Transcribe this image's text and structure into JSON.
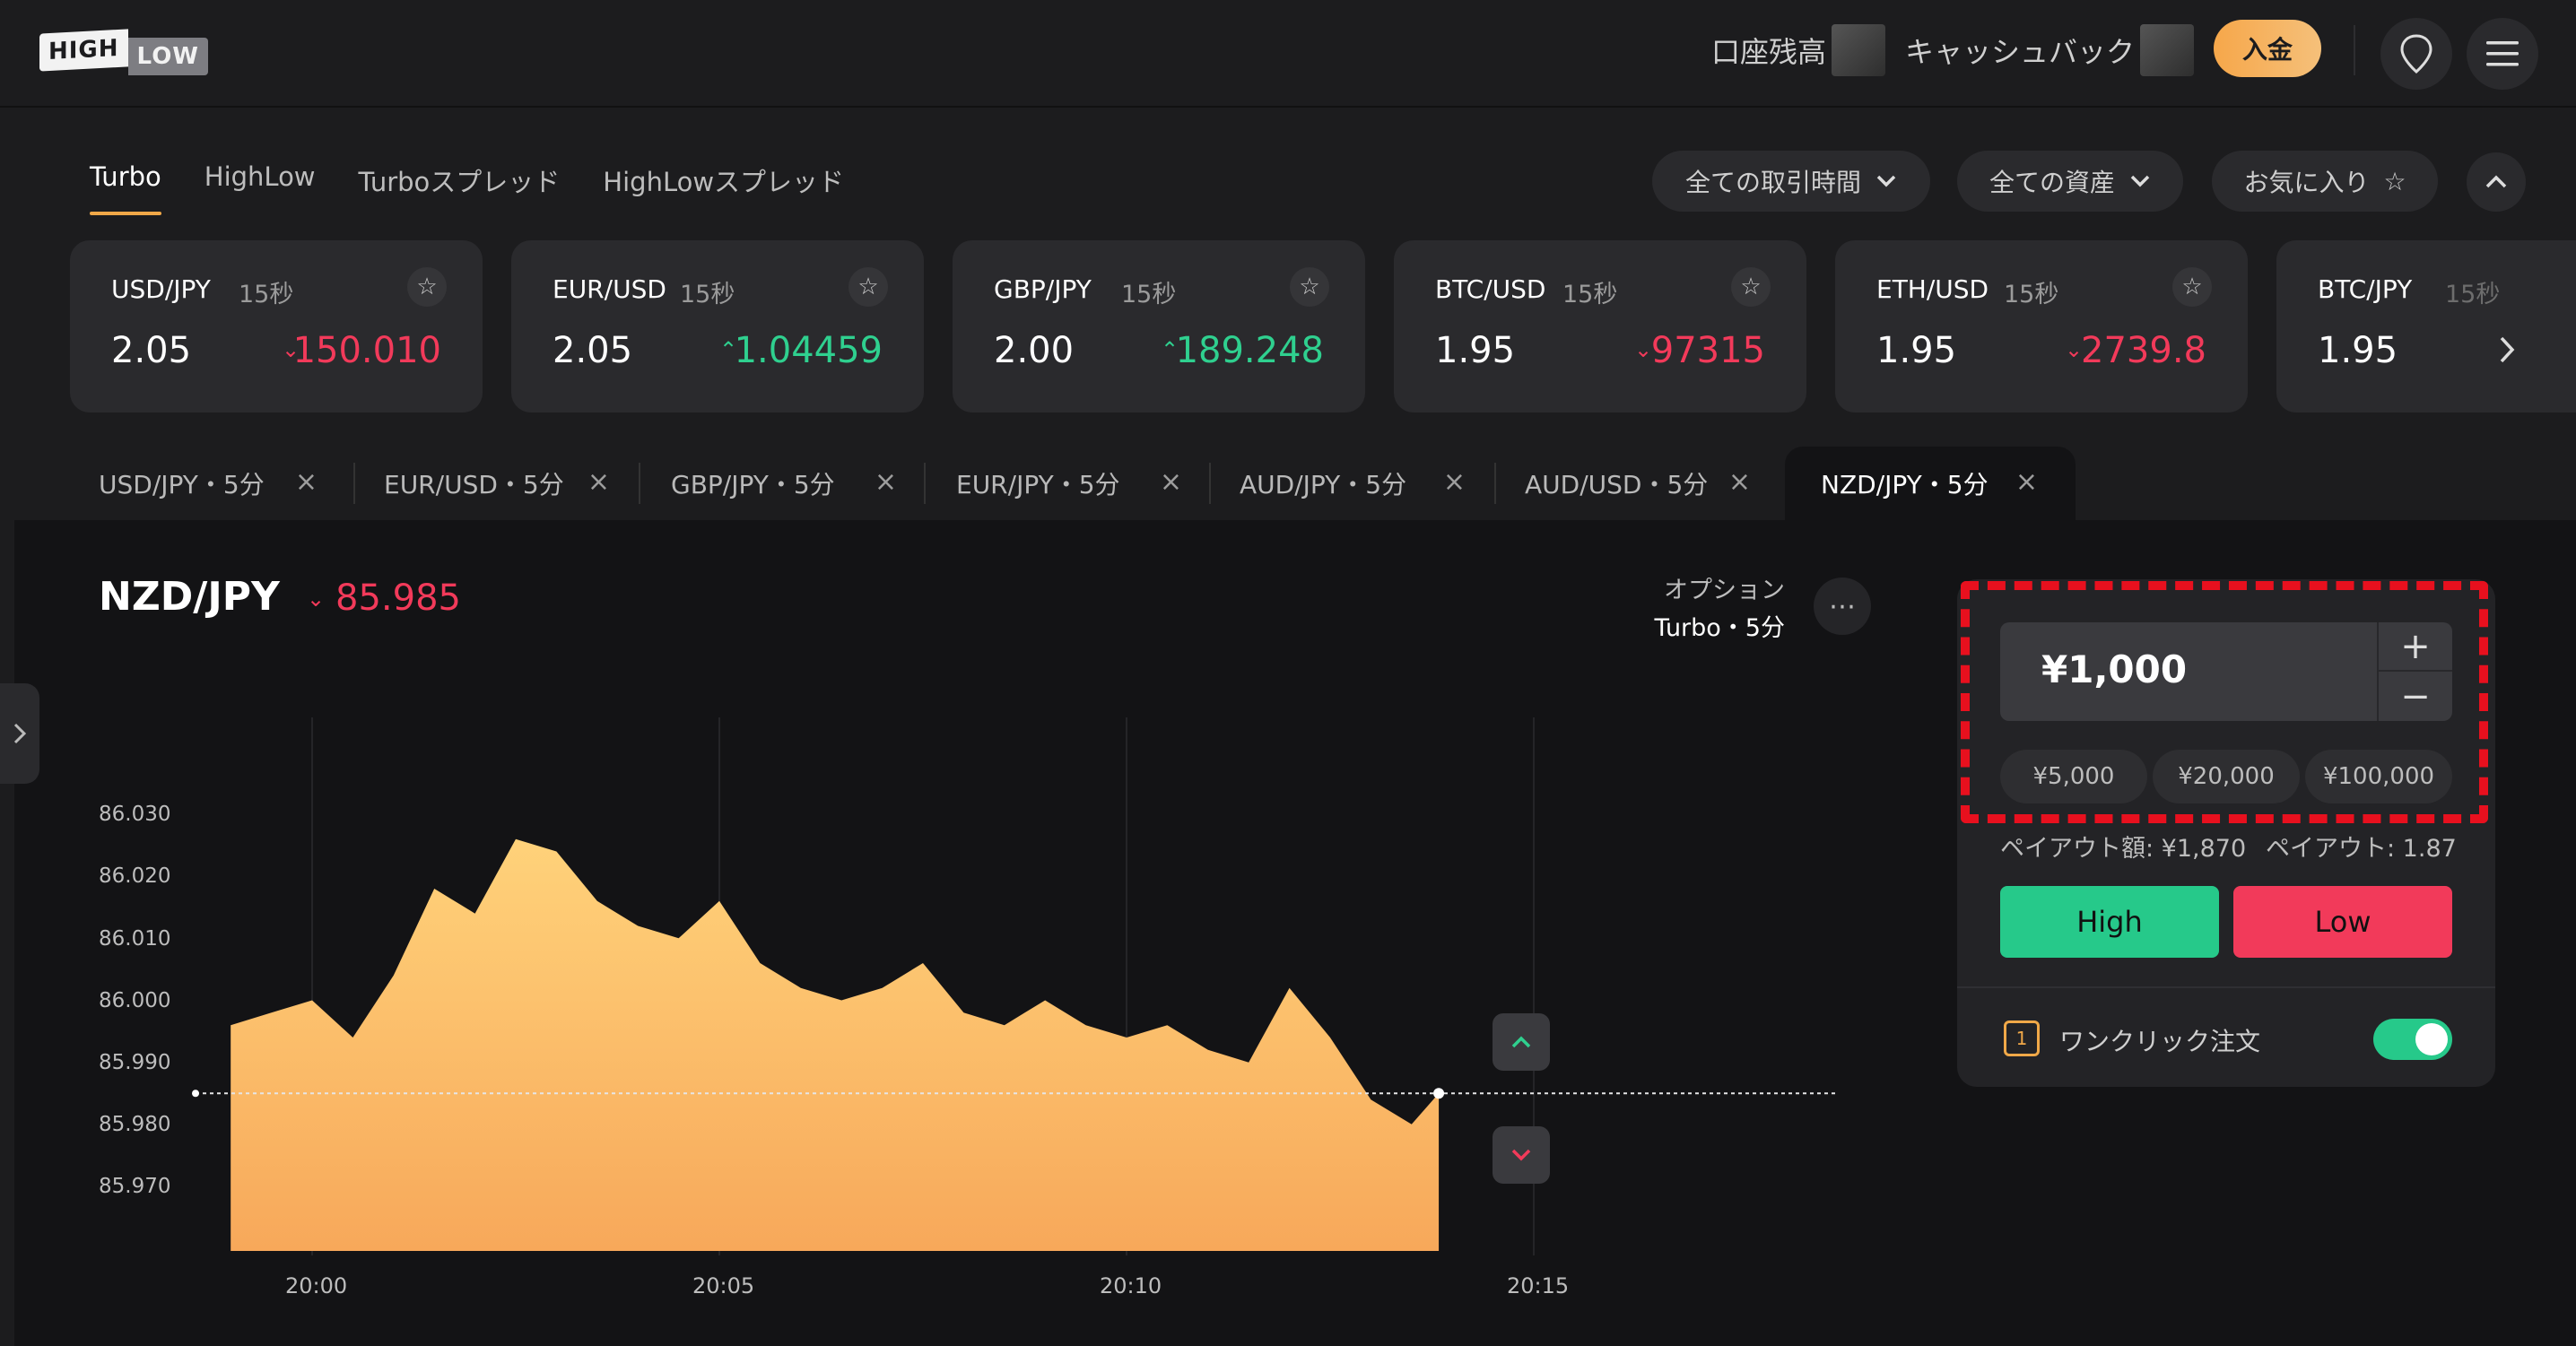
{
  "header": {
    "logo_high": "HIGH",
    "logo_low": "LOW",
    "balance_label": "口座残高",
    "cashback_label": "キャッシュバック",
    "deposit_label": "入金"
  },
  "product_tabs": [
    "Turbo",
    "HighLow",
    "Turboスプレッド",
    "HighLowスプレッド"
  ],
  "filters": {
    "time": "全ての取引時間",
    "assets": "全ての資産",
    "favorites": "お気に入り"
  },
  "cards": [
    {
      "pair": "USD/JPY",
      "dur": "15秒",
      "payout": "2.05",
      "price": "150.010",
      "dir": "down"
    },
    {
      "pair": "EUR/USD",
      "dur": "15秒",
      "payout": "2.05",
      "price": "1.04459",
      "dir": "up"
    },
    {
      "pair": "GBP/JPY",
      "dur": "15秒",
      "payout": "2.00",
      "price": "189.248",
      "dir": "up"
    },
    {
      "pair": "BTC/USD",
      "dur": "15秒",
      "payout": "1.95",
      "price": "97315",
      "dir": "down"
    },
    {
      "pair": "ETH/USD",
      "dur": "15秒",
      "payout": "1.95",
      "price": "2739.8",
      "dir": "down"
    },
    {
      "pair": "BTC/JPY",
      "dur": "15秒",
      "payout": "1.95",
      "price": "",
      "dir": "down"
    }
  ],
  "chart_tabs": [
    "USD/JPY・5分",
    "EUR/USD・5分",
    "GBP/JPY・5分",
    "EUR/JPY・5分",
    "AUD/JPY・5分",
    "AUD/USD・5分",
    "NZD/JPY・5分"
  ],
  "asset": {
    "name": "NZD/JPY",
    "price": "85.985",
    "option_label": "オプション",
    "option_value": "Turbo・5分"
  },
  "trade": {
    "amount": "¥1,000",
    "presets": [
      "¥5,000",
      "¥20,000",
      "¥100,000"
    ],
    "payout_amount": "ペイアウト額: ¥1,870",
    "payout_rate": "ペイアウト: 1.87",
    "high_label": "High",
    "low_label": "Low",
    "oneclick_label": "ワンクリック注文",
    "oneclick_enabled": true
  },
  "colors": {
    "up": "#2fd08f",
    "down": "#f23a5a",
    "accent": "#f0a848",
    "highlight_border": "#e8101e"
  },
  "chart_data": {
    "type": "area",
    "title": "",
    "xlabel": "",
    "ylabel": "",
    "x_ticks": [
      "20:00",
      "20:05",
      "20:10",
      "20:15"
    ],
    "y_ticks": [
      "86.030",
      "86.020",
      "86.010",
      "86.000",
      "85.990",
      "85.980",
      "85.970"
    ],
    "ylim": [
      85.96,
      86.04
    ],
    "current_price": 85.985,
    "series": [
      {
        "x": [
          "19:59",
          "19:59:30",
          "20:00",
          "20:00:30",
          "20:01",
          "20:01:30",
          "20:02",
          "20:02:30",
          "20:03",
          "20:03:30",
          "20:04",
          "20:04:30",
          "20:05",
          "20:05:30",
          "20:06",
          "20:06:30",
          "20:07",
          "20:07:30",
          "20:08",
          "20:08:30",
          "20:09",
          "20:09:30",
          "20:10",
          "20:10:30",
          "20:11",
          "20:11:30",
          "20:12",
          "20:12:30",
          "20:13",
          "20:13:30",
          "20:13:50"
        ],
        "values": [
          85.996,
          85.998,
          86.0,
          85.994,
          86.004,
          86.018,
          86.014,
          86.026,
          86.024,
          86.016,
          86.012,
          86.01,
          86.016,
          86.006,
          86.002,
          86.0,
          86.002,
          86.006,
          85.998,
          85.996,
          86.0,
          85.996,
          85.994,
          85.996,
          85.992,
          85.99,
          86.002,
          85.994,
          85.984,
          85.98,
          85.985
        ]
      }
    ]
  }
}
